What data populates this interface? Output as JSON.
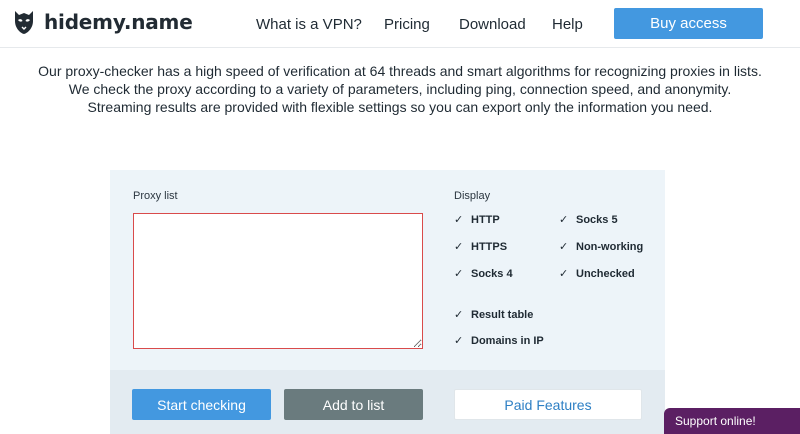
{
  "header": {
    "logo_text": "hidemy.name",
    "logo_icon": "hidemy-mask-icon",
    "nav": [
      "What is a VPN?",
      "Pricing",
      "Download",
      "Help"
    ],
    "buy_label": "Buy access"
  },
  "intro": {
    "lines": [
      "Our proxy-checker has a high speed of verification at 64 threads and smart algorithms for recognizing proxies in lists.",
      "We check the proxy according to a variety of parameters, including ping, connection speed, and anonymity.",
      "Streaming results are provided with flexible settings so you can export only the information you need."
    ]
  },
  "form": {
    "proxy_list_label": "Proxy list",
    "proxy_list_value": "",
    "display_label": "Display",
    "options": [
      {
        "label": "HTTP",
        "checked": true
      },
      {
        "label": "Socks 5",
        "checked": true
      },
      {
        "label": "HTTPS",
        "checked": true
      },
      {
        "label": "Non-working",
        "checked": true
      },
      {
        "label": "Socks 4",
        "checked": true
      },
      {
        "label": "Unchecked",
        "checked": true
      },
      {
        "label": "Result table",
        "checked": true
      },
      {
        "label": "Domains in IP",
        "checked": true
      }
    ],
    "check_glyph": "✓",
    "buttons": {
      "start": "Start checking",
      "add": "Add to list",
      "paid": "Paid Features"
    }
  },
  "support": {
    "label": "Support online!"
  },
  "colors": {
    "accent": "#4398e0",
    "secondary_button": "#6a7b7e",
    "panel_bg": "#edf4f9",
    "textarea_border": "#d94b4b",
    "support_bg": "#5b1f63"
  }
}
